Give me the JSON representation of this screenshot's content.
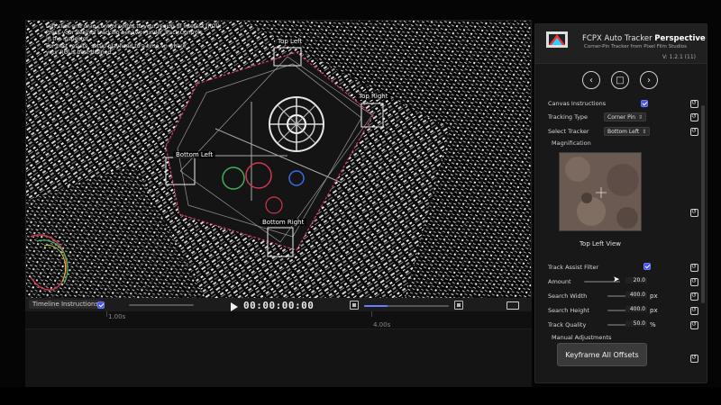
{
  "viewer": {
    "instructions": [
      "Left click and drag control points to your region of interest (ROI).",
      "Press your desired tracking behavior under Track Controls",
      "  in the inspector.",
      "For best results, setup playhead to a time on where",
      "  your ROI is best defined."
    ],
    "corners": {
      "top_left": "Top Left",
      "top_right": "Top Right",
      "bottom_left": "Bottom Left",
      "bottom_right": "Bottom Right"
    }
  },
  "timeline": {
    "label": "Timeline Instructions",
    "timecode": "00:00:00:00",
    "ticks": [
      "1.00s",
      "4.00s"
    ]
  },
  "panel": {
    "title_plain": "FCPX Auto Tracker ",
    "title_bold": "Perspective",
    "subtitle": "Corner-Pin Tracker from Pixel Film Studios",
    "version": "V: 1.2.1 (11)",
    "nav": {
      "prev": "‹",
      "stop": "□",
      "next": "›"
    },
    "canvas_instructions": "Canvas Instructions",
    "tracking_type_label": "Tracking Type",
    "tracking_type_value": "Corner Pin",
    "select_tracker_label": "Select Tracker",
    "select_tracker_value": "Bottom Left",
    "magnification": "Magnification",
    "view_caption": "Top Left View",
    "track_assist_filter": "Track Assist Filter",
    "amount_label": "Amount",
    "amount_value": "20.0",
    "search_width_label": "Search Width",
    "search_width_value": "400.0",
    "search_height_label": "Search Height",
    "search_height_value": "400.0",
    "track_quality_label": "Track Quality",
    "track_quality_value": "50.0",
    "unit_px": "px",
    "unit_pct": "%",
    "manual_adjustments": "Manual Adjustments",
    "keyframe_button": "Keyframe All Offsets"
  },
  "colors": {
    "accent": "#4a55e8",
    "panel_bg": "#181818",
    "viewer_bg": "#0a0a0a"
  }
}
